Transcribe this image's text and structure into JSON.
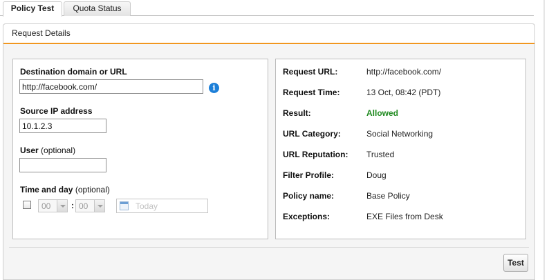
{
  "tabs": [
    {
      "label": "Policy Test",
      "active": true
    },
    {
      "label": "Quota Status",
      "active": false
    }
  ],
  "panel": {
    "title": "Request Details",
    "accent_color": "#f19720"
  },
  "form": {
    "destination_label": "Destination domain or URL",
    "destination_value": "http://facebook.com/",
    "info_icon": "info-icon",
    "source_ip_label": "Source IP address",
    "source_ip_value": "10.1.2.3",
    "user_label": "User",
    "user_optional": "(optional)",
    "user_value": "",
    "time_label": "Time and day",
    "time_optional": "(optional)",
    "hour_value": "00",
    "minute_value": "00",
    "time_separator": ":",
    "date_placeholder": "Today"
  },
  "result": {
    "rows": [
      {
        "key": "Request URL:",
        "value": "http://facebook.com/"
      },
      {
        "key": "Request Time:",
        "value": "13 Oct, 08:42 (PDT)"
      },
      {
        "key": "Result:",
        "value": "Allowed"
      },
      {
        "key": "URL Category:",
        "value": "Social Networking"
      },
      {
        "key": "URL Reputation:",
        "value": "Trusted"
      },
      {
        "key": "Filter Profile:",
        "value": "Doug"
      },
      {
        "key": "Policy name:",
        "value": "Base Policy"
      },
      {
        "key": "Exceptions:",
        "value": "EXE Files from Desk"
      }
    ],
    "allowed_color": "#1f8a1f"
  },
  "footer": {
    "test_label": "Test"
  }
}
